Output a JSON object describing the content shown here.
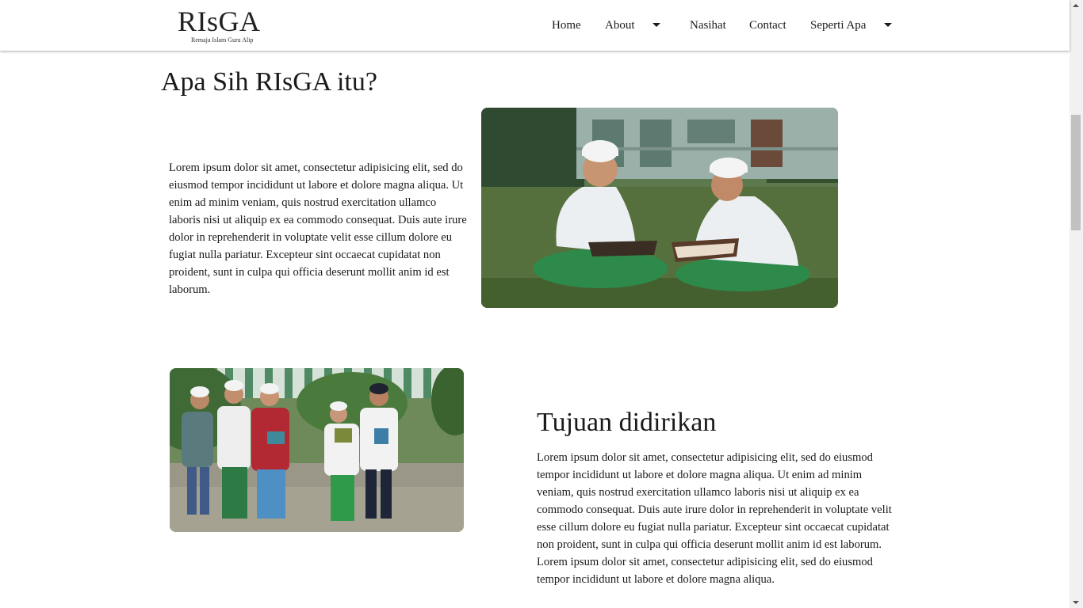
{
  "nav": {
    "logo_text": "RIsGA",
    "logo_subtitle": "Remaja Islam Guru Alip",
    "items": [
      {
        "label": "Home",
        "has_dropdown": false
      },
      {
        "label": "About",
        "has_dropdown": true
      },
      {
        "label": "Nasihat",
        "has_dropdown": false
      },
      {
        "label": "Contact",
        "has_dropdown": false
      },
      {
        "label": "Seperti Apa",
        "has_dropdown": true
      }
    ]
  },
  "section1": {
    "title": "Apa Sih RIsGA itu?",
    "paragraph": "Lorem ipsum dolor sit amet, consectetur adipisicing elit, sed do eiusmod tempor incididunt ut labore et dolore magna aliqua. Ut enim ad minim veniam, quis nostrud exercitation ullamco laboris nisi ut aliquip ex ea commodo consequat. Duis aute irure dolor in reprehenderit in voluptate velit esse cillum dolore eu fugiat nulla pariatur. Excepteur sint occaecat cupidatat non proident, sunt in culpa qui officia deserunt mollit anim id est laborum.",
    "image_subject": "two boys in white caps reading books on grass"
  },
  "section2": {
    "title": "Tujuan didirikan",
    "paragraph": "Lorem ipsum dolor sit amet, consectetur adipisicing elit, sed do eiusmod tempor incididunt ut labore et dolore magna aliqua. Ut enim ad minim veniam, quis nostrud exercitation ullamco laboris nisi ut aliquip ex ea commodo consequat. Duis aute irure dolor in reprehenderit in voluptate velit esse cillum dolore eu fugiat nulla pariatur. Excepteur sint occaecat cupidatat non proident, sunt in culpa qui officia deserunt mollit anim id est laborum. Lorem ipsum dolor sit amet, consectetur adipisicing elit, sed do eiusmod tempor incididunt ut labore et dolore magna aliqua.",
    "image_subject": "group of children walking with books"
  },
  "colors": {
    "text": "#1a1a1a",
    "navbar_bg": "#ffffff",
    "grass": "#4e6b3a",
    "sarong_green": "#2f8a4a"
  },
  "icons": [
    "caret-down-icon"
  ]
}
